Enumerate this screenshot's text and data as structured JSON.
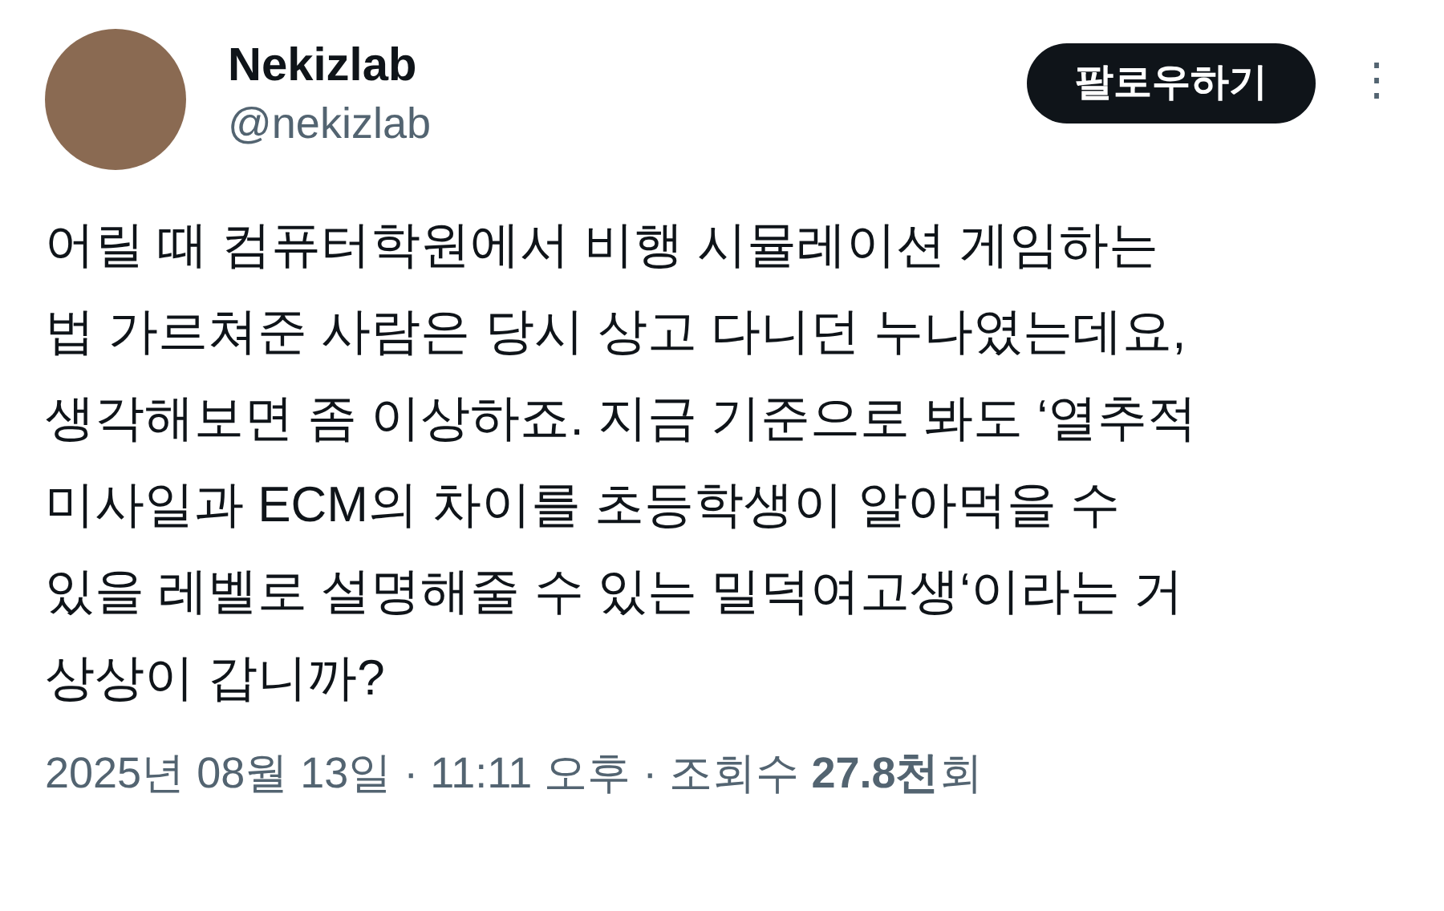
{
  "author": {
    "name": "Nekizlab",
    "handle": "@nekizlab"
  },
  "follow_button": "팔로우하기",
  "more_menu": "⋮",
  "text": "어릴 때 컴퓨터학원에서 비행 시뮬레이션 게임하는\n법 가르쳐준 사람은 당시 상고 다니던 누나였는데요,\n생각해보면 좀 이상하죠. 지금 기준으로 봐도 ‘열추적\n미사일과 ECM의 차이를 초등학생이 알아먹을 수\n있을 레벨로 설명해줄 수 있는 밀덕여고생‘이라는 거\n상상이 갑니까?",
  "meta": "2025년 08월 13일 · 11:11 오후 · 조회수 **27.8천**회"
}
